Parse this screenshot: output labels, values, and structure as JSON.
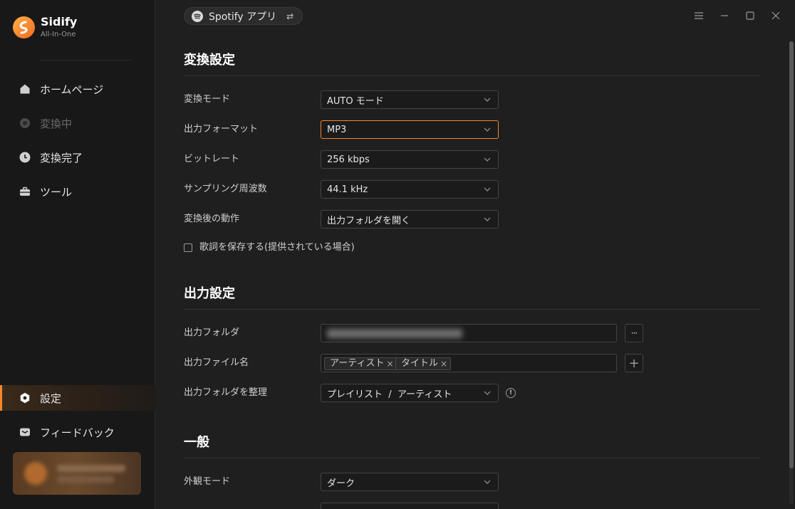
{
  "app": {
    "name": "Sidify",
    "subtitle": "All-In-One",
    "accent": "#f5862b"
  },
  "sidebar": {
    "items": [
      {
        "label": "ホームページ",
        "icon": "home-icon",
        "state": "normal"
      },
      {
        "label": "変換中",
        "icon": "converting-icon",
        "state": "disabled"
      },
      {
        "label": "変換完了",
        "icon": "clock-icon",
        "state": "normal"
      },
      {
        "label": "ツール",
        "icon": "toolbox-icon",
        "state": "normal"
      }
    ],
    "bottom_items": [
      {
        "label": "設定",
        "icon": "gear-icon",
        "state": "active"
      },
      {
        "label": "フィードバック",
        "icon": "mail-icon",
        "state": "normal"
      }
    ]
  },
  "header": {
    "source_label": "Spotify アプリ",
    "source_icon": "spotify-icon",
    "swap_icon": "swap-icon"
  },
  "window_controls": [
    "menu-icon",
    "minimize-icon",
    "maximize-icon",
    "close-icon"
  ],
  "conversion": {
    "title": "変換設定",
    "rows": [
      {
        "label": "変換モード",
        "value": "AUTO モード"
      },
      {
        "label": "出力フォーマット",
        "value": "MP3"
      },
      {
        "label": "ビットレート",
        "value": "256 kbps"
      },
      {
        "label": "サンプリング周波数",
        "value": "44.1 kHz"
      },
      {
        "label": "変換後の動作",
        "value": "出力フォルダを開く"
      }
    ],
    "lyrics_checkbox": {
      "label": "歌詞を保存する(提供されている場合)",
      "checked": false
    }
  },
  "output": {
    "title": "出力設定",
    "folder_label": "出力フォルダ",
    "folder_more": "···",
    "filename_label": "出力ファイル名",
    "filename_tags": [
      "アーティスト",
      "タイトル"
    ],
    "tag_remove": "×",
    "add_tag": "+",
    "organize_label": "出力フォルダを整理",
    "organize_value": "プレイリスト  /  アーティスト",
    "info": "!"
  },
  "general": {
    "title": "一般",
    "appearance_label": "外観モード",
    "appearance_value": "ダーク"
  }
}
